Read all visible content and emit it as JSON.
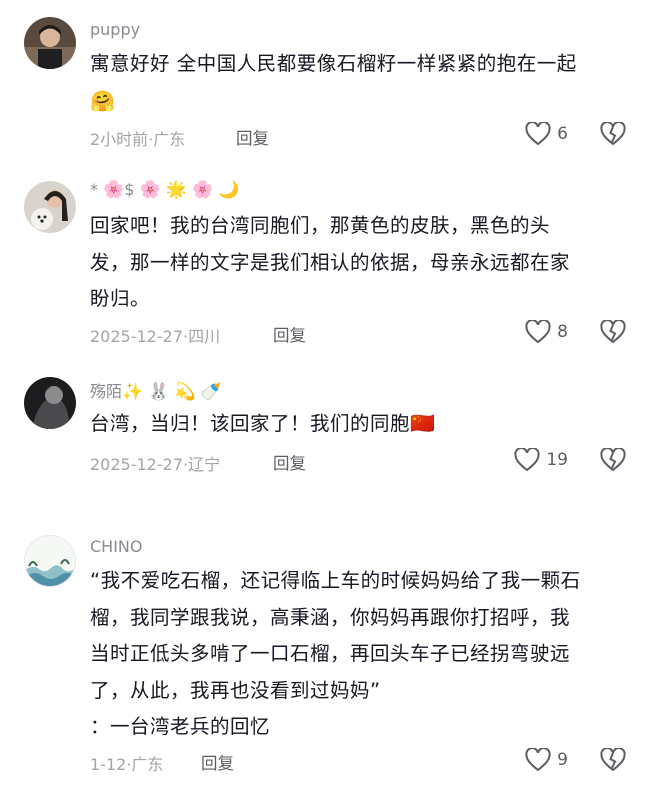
{
  "comments": [
    {
      "username": "puppy",
      "text_lines": [
        "寓意好好 全中国人民都要像石榴籽一样紧紧的抱在一起"
      ],
      "emoji": "🤗",
      "time": "2小时前",
      "location": "广东",
      "reply_label": "回复",
      "likes": "6"
    },
    {
      "username_prefix": "* ",
      "username_emojis": [
        "🌸",
        "$",
        "🌸",
        "🌟",
        "🌸",
        "🌙"
      ],
      "text_lines": [
        "回家吧！我的台湾同胞们，那黄色的皮肤，黑色的头",
        "发，那一样的文字是我们相认的依据，母亲永远都在家",
        "盼归。"
      ],
      "time": "2025-12-27",
      "location": "四川",
      "reply_label": "回复",
      "likes": "8"
    },
    {
      "username": "殇陌",
      "username_emojis": [
        "✨",
        "🐰",
        "💫",
        "🍼"
      ],
      "text_lines": [
        "台湾，当归！该回家了！我们的同胞"
      ],
      "text_flag": "🇨🇳",
      "time": "2025-12-27",
      "location": "辽宁",
      "reply_label": "回复",
      "likes": "19"
    },
    {
      "username": "CHINO",
      "text_lines": [
        "“我不爱吃石榴，还记得临上车的时候妈妈给了我一颗石",
        "榴，我同学跟我说，高秉涵，你妈妈再跟你打招呼，我",
        "当时正低头多啃了一口石榴，再回头车子已经拐弯驶远",
        "了，从此，我再也没看到过妈妈”",
        "：一台湾老兵的回忆"
      ],
      "time": "1-12",
      "location": "广东",
      "reply_label": "回复",
      "likes": "9"
    }
  ],
  "separator": "·",
  "icons": {
    "like": "heart-outline-icon",
    "dislike": "broken-heart-icon"
  },
  "colors": {
    "text": "#161823",
    "meta": "#a3a4a8",
    "username": "#8a8b91"
  }
}
